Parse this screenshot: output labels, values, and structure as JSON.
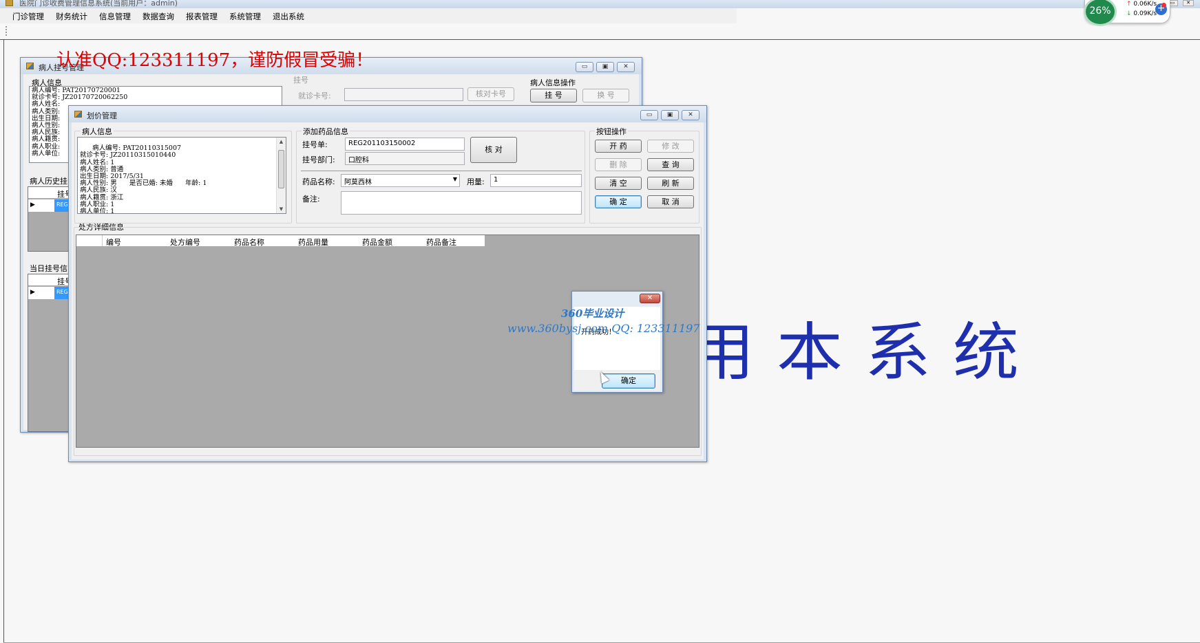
{
  "app": {
    "title": "医院门诊收费管理信息系统(当前用户：admin)",
    "menu": [
      "门诊管理",
      "财务统计",
      "信息管理",
      "数据查询",
      "报表管理",
      "系统管理",
      "退出系统"
    ]
  },
  "background_text": "用本系统",
  "warning_banner": "认准QQ:123311197，谨防假冒受骗！",
  "net_widget": {
    "percent": "26%",
    "up": "0.06K/s",
    "down": "0.09K/s"
  },
  "window_buttons": {
    "minimize": "▭",
    "maximize": "▣",
    "close": "✕"
  },
  "registration_window": {
    "title": "病人挂号管理",
    "group_patient_info": "病人信息",
    "patient_lines": "病人编号: PAT20170720001\n就诊卡号: JZ20170720062250\n病人姓名:\n病人类别:\n出生日期:\n病人性别:\n病人民族:\n病人籍贯:\n病人职业:\n病人单位:",
    "group_register": "挂号",
    "card_label": "就诊卡号:",
    "verify_card_button": "核对卡号",
    "group_operations": "病人信息操作",
    "register_button": "挂 号",
    "change_button": "换 号",
    "history_label": "病人历史挂",
    "history_header": "挂号",
    "history_cell": "REG",
    "today_label": "当日挂号信",
    "today_header": "挂号",
    "today_cell": "REG"
  },
  "pricing_window": {
    "title": "划价管理",
    "group_patient_info": "病人信息",
    "patient_lines": "病人编号: PAT20110315007\n就诊卡号: JZ20110315010440\n病人姓名: 1\n病人类别: 普通\n出生日期: 2017/5/31\n病人性别: 男      是否已婚: 未婚      年龄: 1\n病人民族: 汉\n病人籍贯: 浙江\n病人职业: 1\n病人单位: 1",
    "group_add_drug": "添加药品信息",
    "reg_no_label": "挂号单:",
    "reg_no_value": "REG201103150002",
    "dept_label": "挂号部门:",
    "dept_value": "口腔科",
    "verify_button": "核 对",
    "drug_label": "药品名称:",
    "drug_value": "阿莫西林",
    "dosage_label": "用量:",
    "dosage_value": "1",
    "note_label": "备注:",
    "group_buttons": "按钮操作",
    "buttons": {
      "prescribe": "开 药",
      "modify": "修 改",
      "delete": "删 除",
      "query": "查 询",
      "clear": "清 空",
      "refresh": "刷 新",
      "confirm": "确 定",
      "cancel": "取 消"
    },
    "detail_label": "处方详细信息",
    "columns": [
      "编号",
      "处方编号",
      "药品名称",
      "药品用量",
      "药品金额",
      "药品备注"
    ]
  },
  "dialog": {
    "message": "开药成功！",
    "ok_button": "确定",
    "close": "✕"
  },
  "watermark": {
    "line1": "360毕业设计",
    "line2": "www.360bysj.com     QQ:  123311197"
  }
}
